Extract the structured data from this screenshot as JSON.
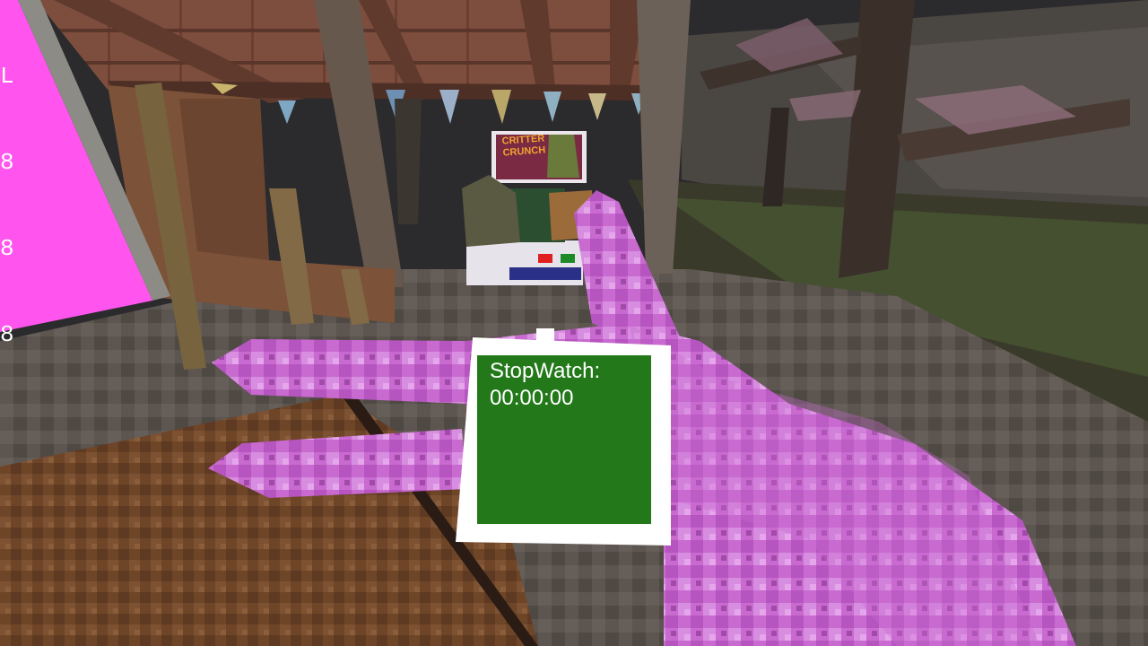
{
  "scene": {
    "type": "vr-first-person",
    "location": "wooden pavilion in a dark forest cave"
  },
  "colors": {
    "hand": "#c86ad0",
    "hand_light": "#e6a6ec",
    "hand_dark": "#a24aaa",
    "watch_frame": "#ffffff",
    "watch_screen": "#23791a",
    "wall_panel": "#ff55ee",
    "floor": "#6f4528",
    "roof": "#7d4e3e",
    "sky_dark": "#2b2a2c"
  },
  "wrist_watch": {
    "label": "StopWatch:",
    "time": "00:00:00"
  },
  "wall_panel": {
    "glyphs": [
      "L",
      "8",
      "8",
      "8"
    ]
  },
  "arcade_machine": {
    "title_line1": "CRITTER",
    "title_line2": "CRUNCH"
  }
}
